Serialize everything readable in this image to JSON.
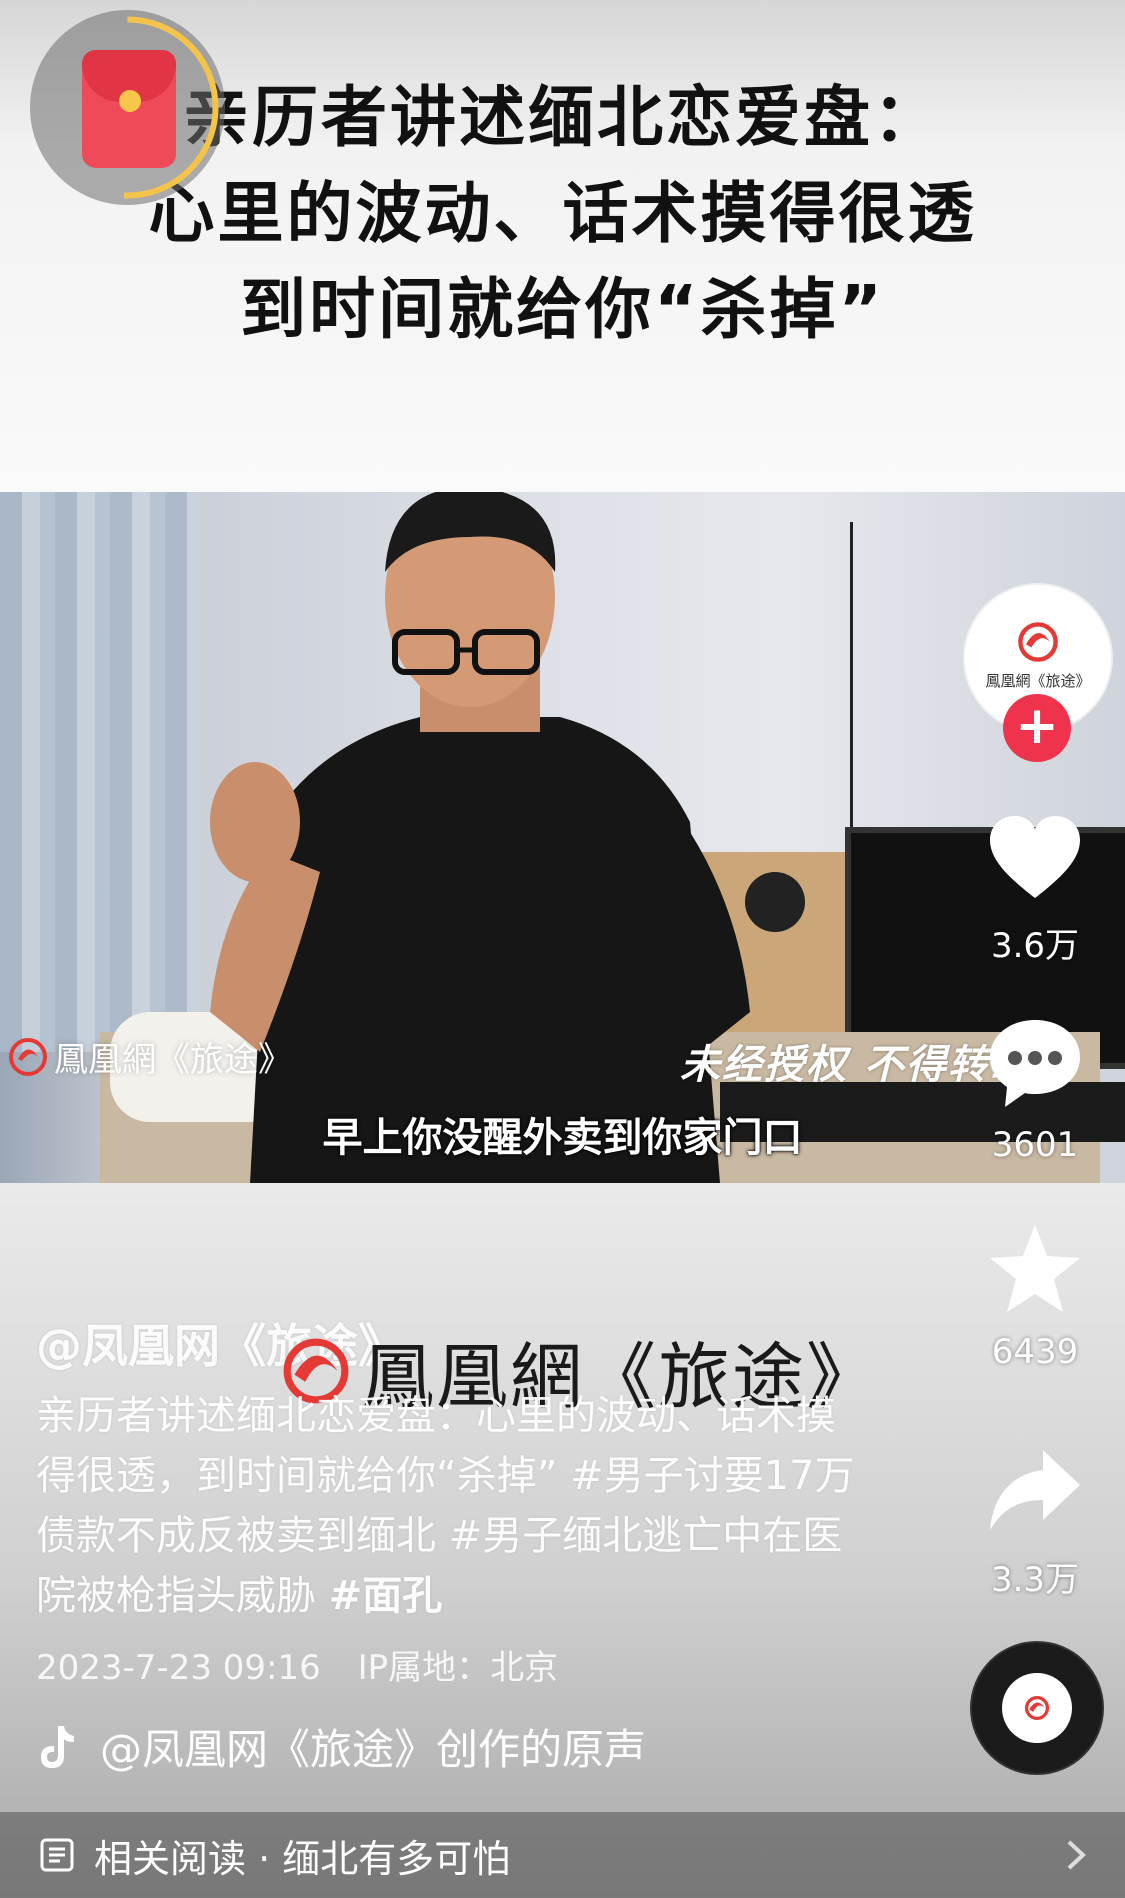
{
  "headline": {
    "line1": "亲历者讲述缅北恋爱盘：",
    "line2": "心里的波动、话术摸得很透",
    "line3": "到时间就给你“杀掉”"
  },
  "video": {
    "watermark_left": "鳳凰網《旅途》",
    "watermark_right": "未经授权 不得转载",
    "subtitle": "早上你没醒外卖到你家门口"
  },
  "creator": {
    "avatar_text": "鳳凰網《旅途》",
    "follow_symbol": "+"
  },
  "actions": {
    "likes": "3.6万",
    "comments": "3601",
    "favorites": "6439",
    "shares": "3.3万"
  },
  "overlay_watermark": "鳳凰網《旅途》",
  "post": {
    "author": "@凤凰网《旅途》",
    "desc_text": "亲历者讲述缅北恋爱盘：心里的波动、话术摸得很透，到时间就给你“杀掉”",
    "tags": [
      "#男子讨要17万债款不成反被卖到缅北",
      "#男子缅北逃亡中在医院被枪指头威胁",
      "#面孔"
    ],
    "date": "2023-7-23 09:16",
    "ip": "IP属地：北京",
    "music": "@凤凰网《旅途》创作的原声"
  },
  "related": {
    "label": "相关阅读 · 缅北有多可怕"
  },
  "colors": {
    "accent_red": "#f0334c",
    "redpacket": "#ef4a5a",
    "progress_ring": "#f3c34a"
  }
}
